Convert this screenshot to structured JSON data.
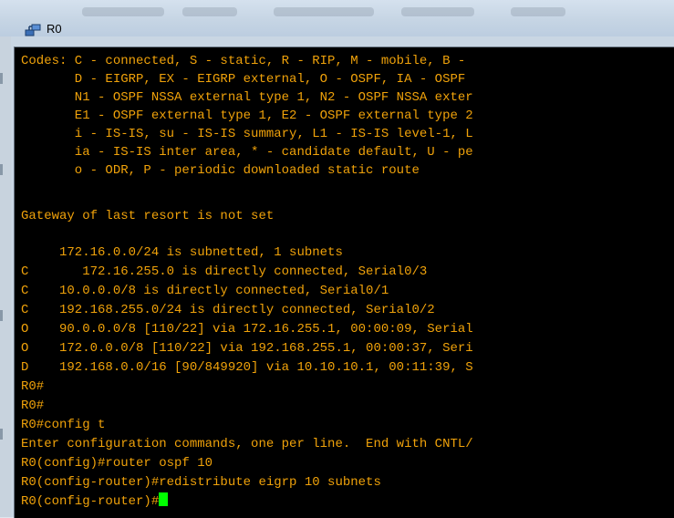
{
  "window": {
    "title": "R0"
  },
  "icons": {
    "app": "router-icon"
  },
  "colors": {
    "terminal_bg": "#000000",
    "terminal_text": "#f0a20a",
    "cursor": "#00ff00"
  },
  "terminal": {
    "lines": [
      "Codes: C - connected, S - static, R - RIP, M - mobile, B -",
      "       D - EIGRP, EX - EIGRP external, O - OSPF, IA - OSPF",
      "       N1 - OSPF NSSA external type 1, N2 - OSPF NSSA exter",
      "       E1 - OSPF external type 1, E2 - OSPF external type 2",
      "       i - IS-IS, su - IS-IS summary, L1 - IS-IS level-1, L",
      "       ia - IS-IS inter area, * - candidate default, U - pe",
      "       o - ODR, P - periodic downloaded static route",
      "",
      "Gateway of last resort is not set",
      "",
      "     172.16.0.0/24 is subnetted, 1 subnets",
      "C       172.16.255.0 is directly connected, Serial0/3",
      "C    10.0.0.0/8 is directly connected, Serial0/1",
      "C    192.168.255.0/24 is directly connected, Serial0/2",
      "O    90.0.0.0/8 [110/22] via 172.16.255.1, 00:00:09, Serial",
      "O    172.0.0.0/8 [110/22] via 192.168.255.1, 00:00:37, Seri",
      "D    192.168.0.0/16 [90/849920] via 10.10.10.1, 00:11:39, S",
      "R0#",
      "R0#",
      "R0#config t",
      "Enter configuration commands, one per line.  End with CNTL/",
      "R0(config)#router ospf 10",
      "R0(config-router)#redistribute eigrp 10 subnets",
      "R0(config-router)#"
    ]
  }
}
